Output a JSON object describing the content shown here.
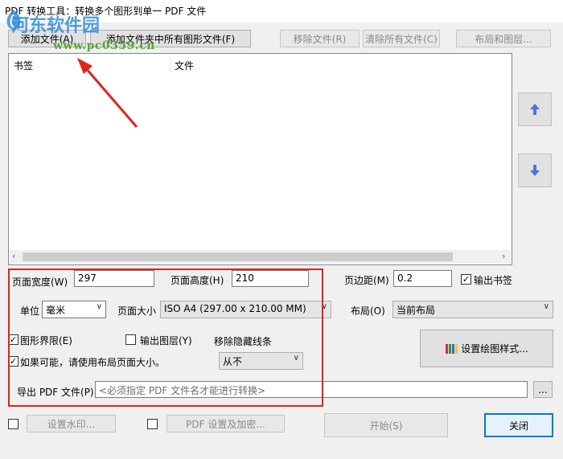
{
  "window": {
    "title": "PDF 转换工具：转换多个图形到单一 PDF 文件"
  },
  "watermark": {
    "text": "河东软件园",
    "url": "www.pc0359.cn"
  },
  "toolbar": {
    "add_file": "添加文件(A)",
    "add_folder": "添加文件夹中所有图形文件(F)",
    "remove_file": "移除文件(R)",
    "clear_all": "清除所有文件(C)",
    "layout": "布局和图层..."
  },
  "list": {
    "col_bookmark": "书签",
    "col_file": "文件"
  },
  "side": {
    "up_icon": "arrow-up-icon",
    "down_icon": "arrow-down-icon"
  },
  "page": {
    "width_label": "页面宽度(W)",
    "width_value": "297",
    "height_label": "页面高度(H)",
    "height_value": "210",
    "margin_label": "页边距(M)",
    "margin_value": "0.2",
    "bookmark_label": "输出书签",
    "bookmark_checked": true,
    "unit_label": "单位",
    "unit_value": "毫米",
    "size_label": "页面大小",
    "size_value": "ISO A4 (297.00 x 210.00 MM)",
    "layout_label": "布局(O)",
    "layout_value": "当前布局"
  },
  "options": {
    "extents_label": "图形界限(E)",
    "extents_checked": true,
    "layers_label": "输出图层(Y)",
    "layers_checked": false,
    "hidden_label": "移除隐藏线条",
    "hidden_value": "从不",
    "use_layout_label": "如果可能，请使用布局页面大小。",
    "use_layout_checked": true,
    "plot_style": "设置绘图样式..."
  },
  "export": {
    "label": "导出 PDF 文件(P)",
    "placeholder": "<必须指定 PDF 文件名才能进行转换>",
    "browse": "..."
  },
  "footer": {
    "watermark_checked": false,
    "watermark_btn": "设置水印...",
    "pdf_settings_checked": false,
    "pdf_settings_btn": "PDF 设置及加密...",
    "start": "开始(S)",
    "close": "关闭"
  },
  "colors": {
    "annotation_red": "#e0231c",
    "accent_blue": "#0078d7"
  }
}
